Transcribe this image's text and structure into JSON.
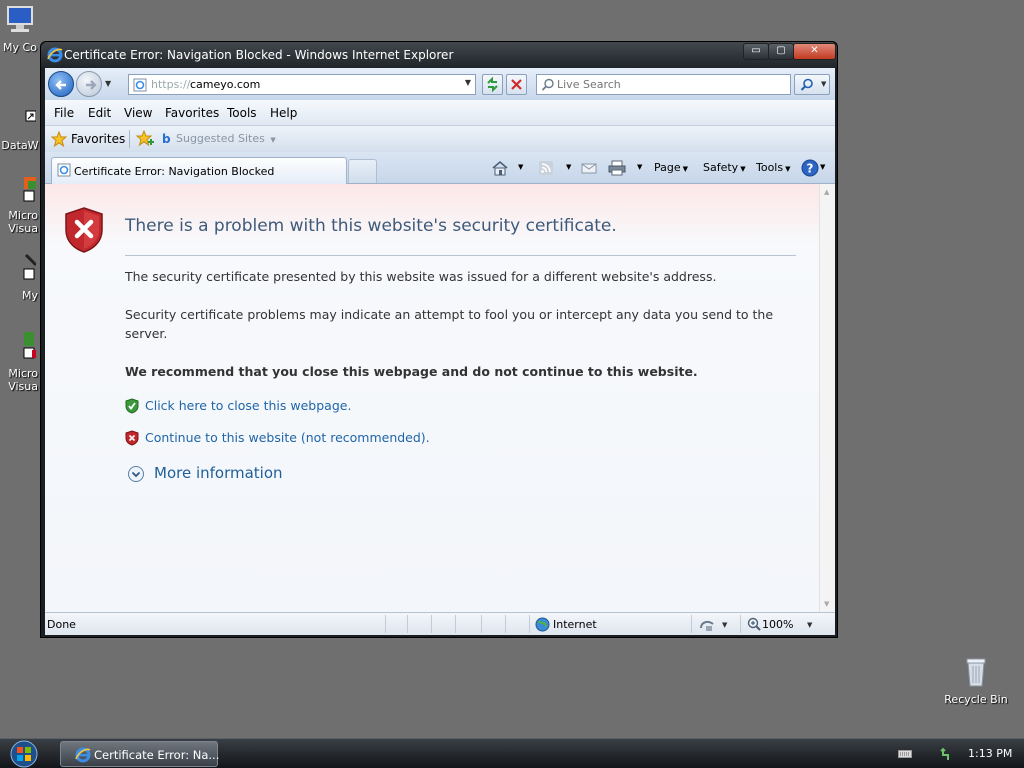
{
  "desktop": {
    "icons": [
      {
        "label": "My Co"
      },
      {
        "label": "DataW"
      },
      {
        "label": "Micro\nVisua"
      },
      {
        "label": "My"
      },
      {
        "label": "Micro\nVisua"
      }
    ],
    "recycle_bin": "Recycle Bin"
  },
  "window": {
    "title": "Certificate Error: Navigation Blocked - Windows Internet Explorer",
    "controls": {
      "minimize": "▭",
      "maximize": "▢",
      "close": "✕"
    }
  },
  "address_bar": {
    "protocol": "https://",
    "host": "cameyo.com",
    "search_placeholder": "Live Search"
  },
  "menu": {
    "items": [
      "File",
      "Edit",
      "View",
      "Favorites",
      "Tools",
      "Help"
    ]
  },
  "favorites_bar": {
    "favorites_label": "Favorites",
    "suggested_label": "Suggested Sites"
  },
  "tab": {
    "label": "Certificate Error: Navigation Blocked"
  },
  "command_bar": {
    "page": "Page",
    "safety": "Safety",
    "tools": "Tools"
  },
  "content": {
    "title": "There is a problem with this website's security certificate.",
    "para1": "The security certificate presented by this website was issued for a different website's address.",
    "para2": "Security certificate problems may indicate an attempt to fool you or intercept any data you send to the server.",
    "recommend": "We recommend that you close this webpage and do not continue to this website.",
    "close_link": "Click here to close this webpage.",
    "continue_link": "Continue to this website (not recommended).",
    "more_info": "More information"
  },
  "status_bar": {
    "status": "Done",
    "zone": "Internet",
    "zoom": "100%"
  },
  "taskbar": {
    "task_label": "Certificate Error: Na...",
    "clock": "1:13 PM"
  },
  "colors": {
    "title_text": "#3e5a7a",
    "link": "#1f65a8",
    "safe_green": "#3c9a3c",
    "danger_red": "#c0282d"
  }
}
